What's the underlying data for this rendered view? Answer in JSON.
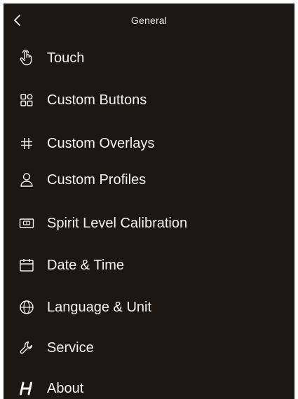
{
  "header": {
    "title": "General",
    "back_icon": "chevron-left-icon"
  },
  "menu": {
    "items": [
      {
        "label": "Touch",
        "icon": "touch-hand-icon"
      },
      {
        "label": "Custom Buttons",
        "icon": "button-grid-icon"
      },
      {
        "label": "Custom Overlays",
        "icon": "hash-grid-icon"
      },
      {
        "label": "Custom Profiles",
        "icon": "user-icon"
      },
      {
        "label": "Spirit Level Calibration",
        "icon": "spirit-level-icon"
      },
      {
        "label": "Date & Time",
        "icon": "calendar-icon"
      },
      {
        "label": "Language & Unit",
        "icon": "globe-icon"
      },
      {
        "label": "Service",
        "icon": "wrench-icon"
      },
      {
        "label": "About",
        "icon": "brand-h-icon"
      }
    ]
  },
  "colors": {
    "background": "#1c1712",
    "text": "#f2f2f2"
  }
}
